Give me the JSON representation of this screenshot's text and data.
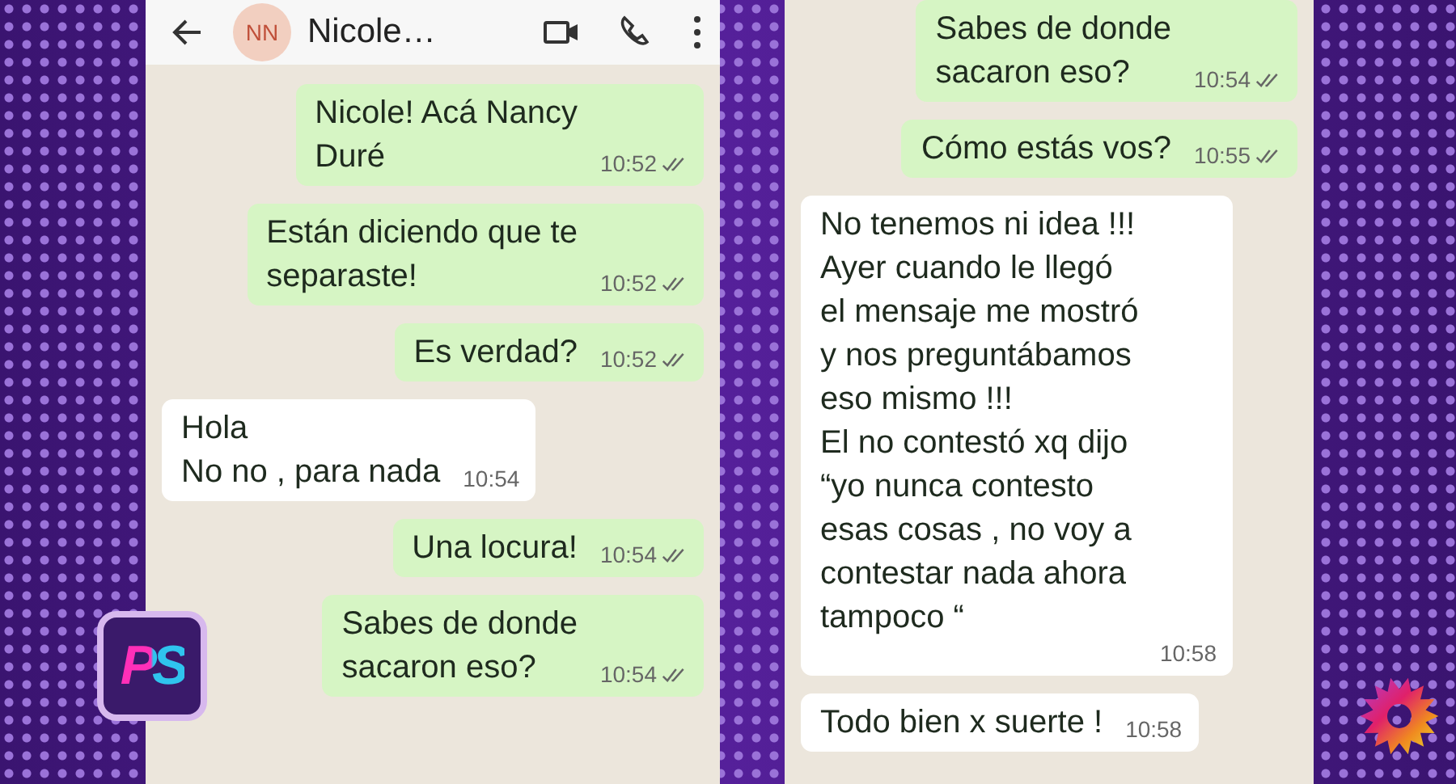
{
  "left_chat": {
    "header": {
      "avatar": "NN",
      "contact": "Nicole…"
    },
    "messages": [
      {
        "kind": "sent",
        "text": "Nicole! Acá Nancy\nDuré",
        "time": "10:52",
        "read": true
      },
      {
        "kind": "sent",
        "text": "Están diciendo que te\nseparaste!",
        "time": "10:52",
        "read": true
      },
      {
        "kind": "sent",
        "text": "Es verdad?",
        "time": "10:52",
        "read": true
      },
      {
        "kind": "received",
        "text": "Hola\nNo no , para nada",
        "time": "10:54",
        "read": false
      },
      {
        "kind": "sent",
        "text": "Una  locura!",
        "time": "10:54",
        "read": true
      },
      {
        "kind": "sent",
        "text": "Sabes de donde\nsacaron eso?",
        "time": "10:54",
        "read": true
      }
    ]
  },
  "right_chat": {
    "messages": [
      {
        "kind": "sent",
        "text": "Sabes de donde\nsacaron eso?",
        "time": "10:54",
        "read": true
      },
      {
        "kind": "sent",
        "text": "Cómo estás vos?",
        "time": "10:55",
        "read": true
      },
      {
        "kind": "received",
        "text": "No tenemos ni idea !!!\nAyer cuando le llegó\nel mensaje me mostró\ny nos preguntábamos\neso mismo !!!\nEl no contestó xq dijo\n“yo nunca contesto\nesas cosas , no voy a\ncontestar nada ahora\ntampoco “",
        "time": "10:58",
        "read": false
      },
      {
        "kind": "received",
        "text": "Todo bien x suerte !",
        "time": "10:58",
        "read": false
      }
    ]
  },
  "channel_logo": {
    "text": "PS"
  }
}
